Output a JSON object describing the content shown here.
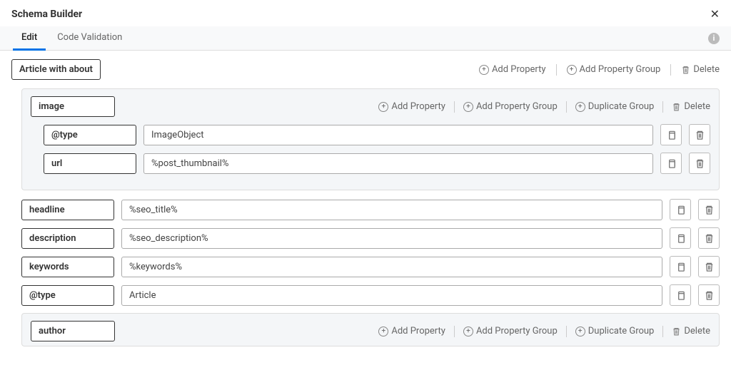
{
  "header": {
    "title": "Schema Builder"
  },
  "tabs": {
    "edit": "Edit",
    "validation": "Code Validation"
  },
  "actions": {
    "add_property": "Add Property",
    "add_property_group": "Add Property Group",
    "duplicate_group": "Duplicate Group",
    "delete": "Delete"
  },
  "root": {
    "name": "Article with about"
  },
  "groups": {
    "image": {
      "name": "image",
      "props": [
        {
          "key": "@type",
          "value": "ImageObject"
        },
        {
          "key": "url",
          "value": "%post_thumbnail%"
        }
      ]
    },
    "author": {
      "name": "author"
    }
  },
  "properties": [
    {
      "key": "headline",
      "value": "%seo_title%"
    },
    {
      "key": "description",
      "value": "%seo_description%"
    },
    {
      "key": "keywords",
      "value": "%keywords%"
    },
    {
      "key": "@type",
      "value": "Article"
    }
  ]
}
